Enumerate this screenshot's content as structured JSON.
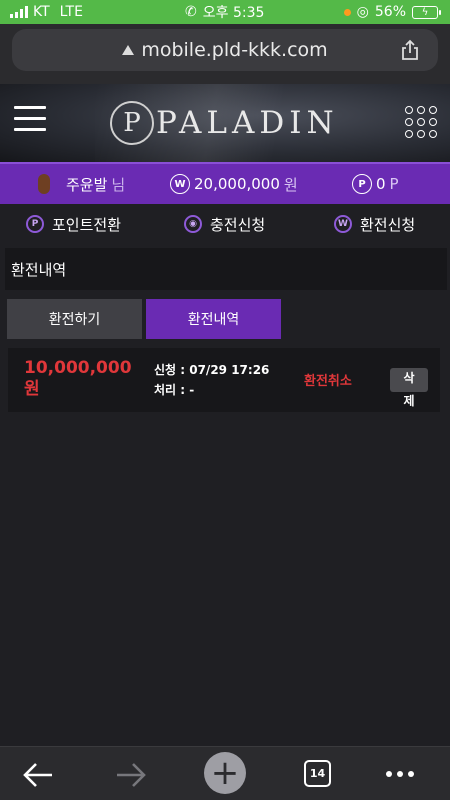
{
  "statusbar": {
    "carrier": "KT",
    "network": "LTE",
    "time": "오후 5:35",
    "battery": "56%"
  },
  "browser": {
    "url": "mobile.pld-kkk.com",
    "tab_count": "14"
  },
  "header": {
    "logo_letter": "P",
    "logo_text": "PALADIN"
  },
  "userbar": {
    "name": "주윤발",
    "name_suffix": "님",
    "money": "20,000,000",
    "money_unit": "원",
    "points": "0",
    "points_unit": "P"
  },
  "actions": [
    {
      "label": "포인트전환",
      "icon": "point-icon"
    },
    {
      "label": "충전신청",
      "icon": "deposit-icon"
    },
    {
      "label": "환전신청",
      "icon": "withdraw-icon"
    }
  ],
  "section_title": "환전내역",
  "tabs": [
    {
      "label": "환전하기",
      "active": false
    },
    {
      "label": "환전내역",
      "active": true
    }
  ],
  "records": [
    {
      "amount": "10,000,000",
      "amount_unit": "원",
      "request": "신청 : 07/29 17:26",
      "processed": "처리 : -",
      "cancel_label": "환전취소",
      "delete_label_1": "삭",
      "delete_label_2": "제"
    }
  ],
  "colors": {
    "accent": "#6a2bb3",
    "danger": "#e0373a",
    "status_green": "#54b948"
  }
}
